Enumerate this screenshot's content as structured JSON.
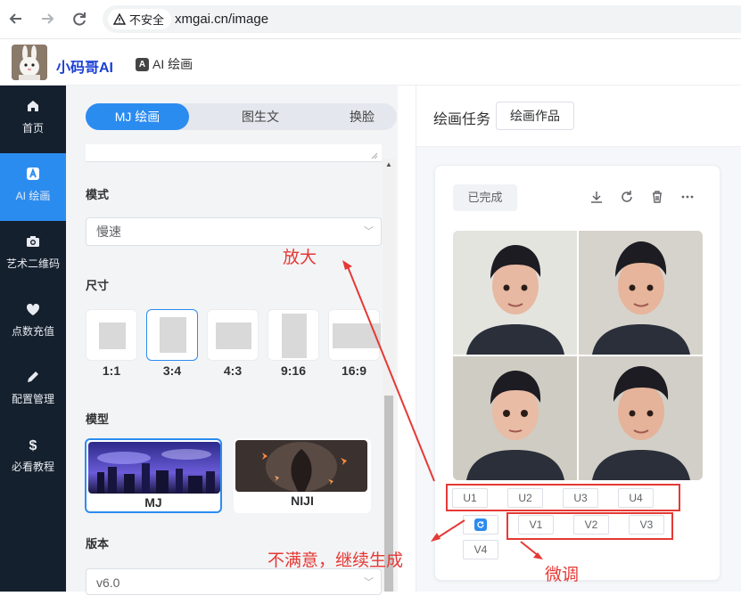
{
  "browser": {
    "back_icon": "arrow-left-icon",
    "forward_icon": "arrow-right-icon",
    "reload_icon": "reload-icon",
    "security_label": "不安全",
    "url": "xmgai.cn/image"
  },
  "header": {
    "brand": "小码哥AI",
    "nav_label": "AI 绘画",
    "nav_badge": "A"
  },
  "sidebar": {
    "items": [
      {
        "label": "首页",
        "icon": "home-icon"
      },
      {
        "label": "AI 绘画",
        "icon": "ai-icon"
      },
      {
        "label": "艺术二维码",
        "icon": "camera-icon"
      },
      {
        "label": "点数充值",
        "icon": "heart-icon"
      },
      {
        "label": "配置管理",
        "icon": "pencil-icon"
      },
      {
        "label": "必看教程",
        "icon": "dollar-icon"
      }
    ]
  },
  "panel": {
    "tabs": [
      "MJ 绘画",
      "图生文",
      "换脸"
    ],
    "mode_label": "模式",
    "mode_value": "慢速",
    "size_label": "尺寸",
    "sizes": [
      "1:1",
      "3:4",
      "4:3",
      "9:16",
      "16:9"
    ],
    "model_label": "模型",
    "models": [
      "MJ",
      "NIJI"
    ],
    "version_label": "版本",
    "version_value": "v6.0"
  },
  "task": {
    "title": "绘画任务",
    "works_button": "绘画作品",
    "status": "已完成",
    "upscale_buttons": [
      "U1",
      "U2",
      "U3",
      "U4"
    ],
    "variation_buttons": [
      "V1",
      "V2",
      "V3",
      "V4"
    ]
  },
  "annotations": {
    "upscale": "放大",
    "regenerate": "不满意，继续生成",
    "variation": "微调"
  },
  "colors": {
    "accent": "#2b8cf0",
    "sidebar_bg": "#15202e",
    "annotation_red": "#e53935"
  }
}
